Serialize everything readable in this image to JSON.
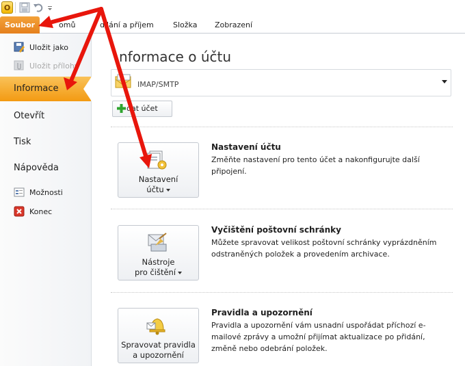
{
  "qat": {
    "icons": [
      "app-logo-icon",
      "save-icon",
      "undo-icon",
      "customize-qat-icon"
    ],
    "logo_letter": "O"
  },
  "ribbon": {
    "file_tab": "Soubor",
    "tabs": [
      "omů",
      "dílání a příjem",
      "Složka",
      "Zobrazení"
    ]
  },
  "nav": {
    "save_as": "Uložit jako",
    "save_attachments": "Uložit přílohy",
    "info": "Informace",
    "open": "Otevřít",
    "print": "Tisk",
    "help": "Nápověda",
    "options": "Možnosti",
    "exit": "Konec"
  },
  "main": {
    "title": "nformace o účtu",
    "account_type": "IMAP/SMTP",
    "add_account": "dat účet",
    "sections": [
      {
        "button_line1": "Nastavení",
        "button_line2": "účtu",
        "title": "Nastavení účtu",
        "description": "Změňte nastavení pro tento účet a nakonfigurujte další připojení."
      },
      {
        "button_line1": "Nástroje",
        "button_line2": "pro čištění",
        "title": "Vyčištění poštovní schránky",
        "description": "Můžete spravovat velikost poštovní schránky vyprázdněním odstraněných položek a provedením archivace."
      },
      {
        "button_line1": "Spravovat pravidla",
        "button_line2": "a upozornění",
        "title": "Pravidla a upozornění",
        "description": "Pravidla a upozornění vám usnadní uspořádat příchozí e-mailové zprávy a umožní přijímat aktualizace po přidání, změně nebo odebrání položek."
      }
    ]
  },
  "colors": {
    "accent_orange": "#f39a12",
    "annotation_red": "#e8160c",
    "add_green": "#2fa52f"
  }
}
